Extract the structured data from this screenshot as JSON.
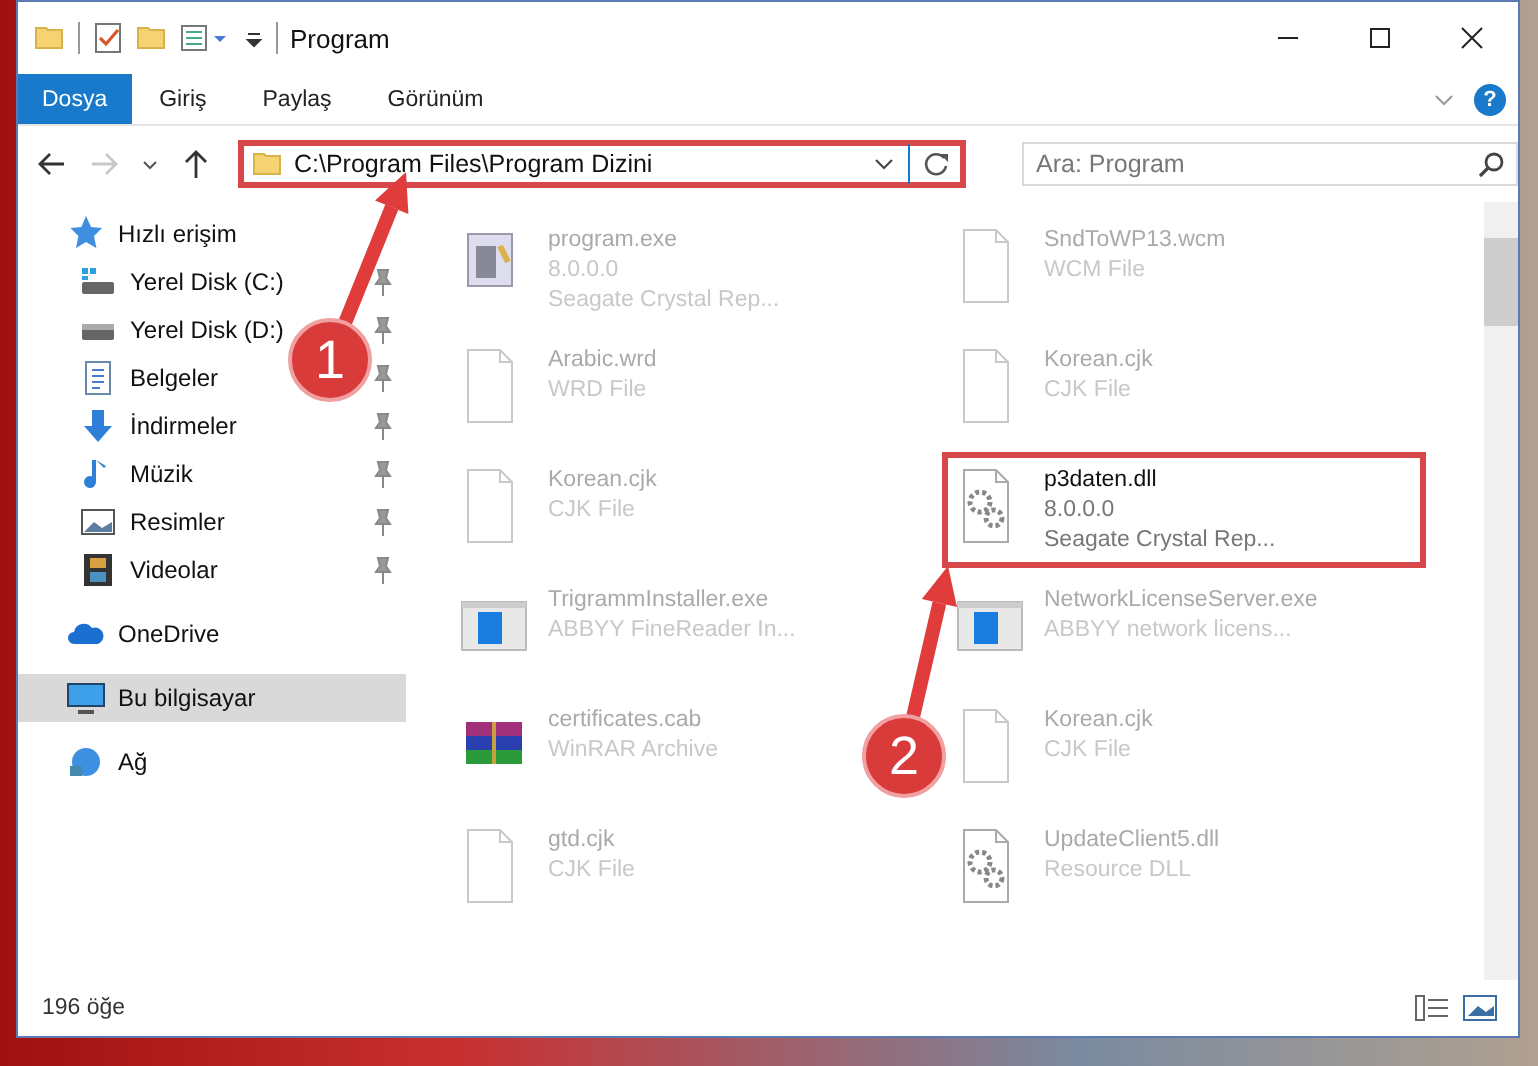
{
  "window": {
    "title": "Program"
  },
  "ribbon": {
    "tabs": [
      {
        "label": "Dosya",
        "selected": true
      },
      {
        "label": "Giriş",
        "selected": false
      },
      {
        "label": "Paylaş",
        "selected": false
      },
      {
        "label": "Görünüm",
        "selected": false
      }
    ],
    "help": "?"
  },
  "address_bar": {
    "path": "C:\\Program Files\\Program Dizini",
    "highlighted": true,
    "forward_disabled": true
  },
  "search": {
    "placeholder": "Ara: Program"
  },
  "sidebar": {
    "items": [
      {
        "label": "Hızlı erişim",
        "kind": "star",
        "selected": false,
        "children": [
          {
            "label": "Yerel Disk (C:)",
            "kind": "drive-c",
            "selected": false,
            "pinned": true
          },
          {
            "label": "Yerel Disk (D:)",
            "kind": "drive",
            "selected": false,
            "pinned": true
          },
          {
            "label": "Belgeler",
            "kind": "docs",
            "selected": false,
            "pinned": true
          },
          {
            "label": "İndirmeler",
            "kind": "download",
            "selected": false,
            "pinned": true
          },
          {
            "label": "Müzik",
            "kind": "music",
            "selected": false,
            "pinned": true
          },
          {
            "label": "Resimler",
            "kind": "pictures",
            "selected": false,
            "pinned": true
          },
          {
            "label": "Videolar",
            "kind": "videos",
            "selected": false,
            "pinned": true
          }
        ]
      },
      {
        "label": "OneDrive",
        "kind": "cloud",
        "selected": false
      },
      {
        "label": "Bu bilgisayar",
        "kind": "pc",
        "selected": true
      },
      {
        "label": "Ağ",
        "kind": "network",
        "selected": false
      }
    ]
  },
  "files": [
    {
      "name": "program.exe",
      "lines": [
        "8.0.0.0",
        "Seagate Crystal Rep..."
      ],
      "kind": "app",
      "highlighted": false
    },
    {
      "name": "SndToWP13.wcm",
      "lines": [
        "WCM File"
      ],
      "kind": "blank",
      "highlighted": false
    },
    {
      "name": "Arabic.wrd",
      "lines": [
        "WRD File"
      ],
      "kind": "blank",
      "highlighted": false
    },
    {
      "name": "Korean.cjk",
      "lines": [
        "CJK File"
      ],
      "kind": "blank",
      "highlighted": false
    },
    {
      "name": "Korean.cjk",
      "lines": [
        "CJK File"
      ],
      "kind": "blank",
      "highlighted": false
    },
    {
      "name": "p3daten.dll",
      "lines": [
        "8.0.0.0",
        "Seagate Crystal Rep..."
      ],
      "kind": "gears",
      "highlighted": true
    },
    {
      "name": "TrigrammInstaller.exe",
      "lines": [
        "ABBYY FineReader In..."
      ],
      "kind": "installer",
      "highlighted": false
    },
    {
      "name": "NetworkLicenseServer.exe",
      "lines": [
        "ABBYY network licens..."
      ],
      "kind": "installer",
      "highlighted": false
    },
    {
      "name": "certificates.cab",
      "lines": [
        "WinRAR Archive"
      ],
      "kind": "archive",
      "highlighted": false
    },
    {
      "name": "Korean.cjk",
      "lines": [
        "CJK File"
      ],
      "kind": "blank",
      "highlighted": false
    },
    {
      "name": "gtd.cjk",
      "lines": [
        "CJK File"
      ],
      "kind": "blank",
      "highlighted": false
    },
    {
      "name": "UpdateClient5.dll",
      "lines": [
        "Resource DLL"
      ],
      "kind": "gears",
      "highlighted": false
    }
  ],
  "status_bar": {
    "count": "196 öğe"
  },
  "annotations": [
    {
      "number": "1"
    },
    {
      "number": "2"
    }
  ]
}
